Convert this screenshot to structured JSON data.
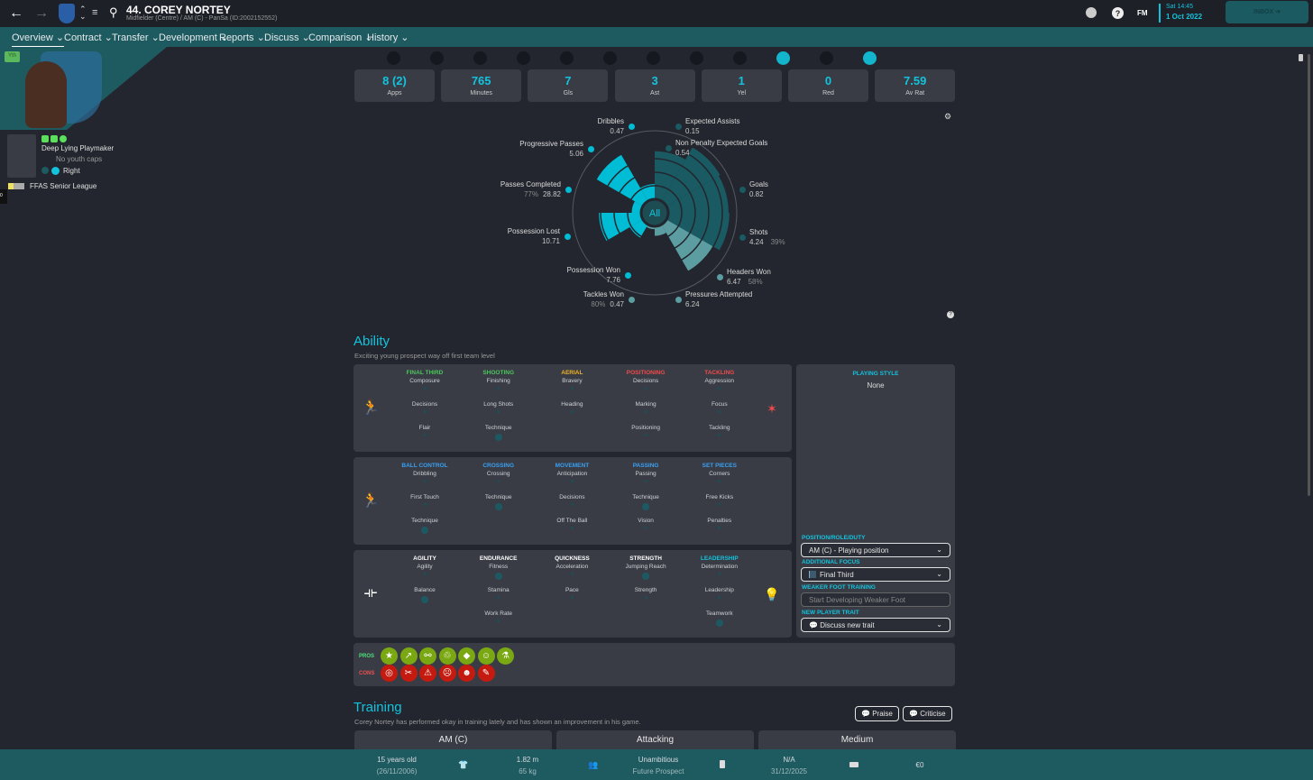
{
  "header": {
    "player_title": "44. COREY NORTEY",
    "subtitle": "Midfielder (Centre) / AM (C) - PanSa (ID:2002152552)",
    "time": "Sat 14:45",
    "date": "1 Oct 2022",
    "fm_label": "FM",
    "inbox_label": "INBOX",
    "icons": [
      "back-arrow-icon",
      "forward-arrow-icon",
      "club-crest-icon",
      "up-down-icon",
      "menu-icon",
      "search-icon",
      "world-icon",
      "help-icon"
    ]
  },
  "nav": {
    "items": [
      {
        "label": "Overview ⌄",
        "active": true
      },
      {
        "label": "Contract ⌄"
      },
      {
        "label": "Transfer ⌄"
      },
      {
        "label": "Development ⌄"
      },
      {
        "label": "Reports ⌄"
      },
      {
        "label": "Discuss ⌄"
      },
      {
        "label": "Comparison ⌄"
      },
      {
        "label": "History ⌄"
      }
    ]
  },
  "player": {
    "badge": "Yth",
    "role": "Deep Lying Playmaker",
    "youth_caps": "No youth caps",
    "foot": "Right",
    "league": "FFAS Senior League",
    "side_tab": "0"
  },
  "stats": [
    {
      "value": "8 (2)",
      "label": "Apps"
    },
    {
      "value": "765",
      "label": "Minutes"
    },
    {
      "value": "7",
      "label": "Gls"
    },
    {
      "value": "3",
      "label": "Ast"
    },
    {
      "value": "1",
      "label": "Yel"
    },
    {
      "value": "0",
      "label": "Red"
    },
    {
      "value": "7.59",
      "label": "Av Rat"
    }
  ],
  "stat_icons": [
    {
      "name": "anchor-icon"
    },
    {
      "name": "book-icon"
    },
    {
      "name": "snail-icon"
    },
    {
      "name": "hammer-sickle-icon"
    },
    {
      "name": "eye-icon"
    },
    {
      "name": "tag-icon"
    },
    {
      "name": "skull-icon"
    },
    {
      "name": "gear-icon"
    },
    {
      "name": "horse-icon"
    },
    {
      "name": "witch-hat-icon",
      "active": true
    },
    {
      "name": "crosshair-icon"
    },
    {
      "name": "fox-icon",
      "active": true
    }
  ],
  "colors": {
    "accent": "#13c3dd",
    "possession": "#00bcd4",
    "attacking": "#1a5a62",
    "defending": "#5c9da2",
    "pros": "#7aa812",
    "cons": "#c41a10"
  },
  "chart_data": {
    "type": "radial-bar",
    "center_label": "All",
    "metrics": [
      {
        "label": "Expected Assists",
        "value": "0.15",
        "group": "attacking",
        "rank": 0.75
      },
      {
        "label": "Non Penalty Expected Goals",
        "value": "0.54",
        "group": "attacking",
        "rank": 0.92
      },
      {
        "label": "Goals",
        "value": "0.82",
        "group": "attacking",
        "rank": 0.9
      },
      {
        "label": "Shots",
        "value": "4.24",
        "pct": "39%",
        "group": "attacking",
        "rank": 0.91
      },
      {
        "label": "Headers Won",
        "value": "6.47",
        "pct": "58%",
        "group": "defending",
        "rank": 0.82
      },
      {
        "label": "Pressures Attempted",
        "value": "6.24",
        "group": "defending",
        "rank": 0.28
      },
      {
        "label": "Tackles Won",
        "value": "0.47",
        "pct": "80%",
        "group": "defending",
        "rank": 0.2
      },
      {
        "label": "Possession Won",
        "value": "7.76",
        "group": "possession",
        "rank": 0.35
      },
      {
        "label": "Possession Lost",
        "value": "10.71",
        "group": "possession",
        "rank": 0.68
      },
      {
        "label": "Passes Completed",
        "value": "28.82",
        "pct": "77%",
        "group": "possession",
        "rank": 0.28
      },
      {
        "label": "Progressive Passes",
        "value": "5.06",
        "group": "possession",
        "rank": 0.82
      },
      {
        "label": "Dribbles",
        "value": "0.47",
        "group": "possession",
        "rank": 0.35
      }
    ]
  },
  "ability": {
    "title": "Ability",
    "subtitle": "Exciting young prospect way off first team level",
    "panels": [
      {
        "icon": "striker-icon",
        "icon_color": "#4cc65a",
        "groups": [
          {
            "name": "FINAL THIRD",
            "color": "#4cc65a",
            "attrs": [
              {
                "n": "Composure"
              },
              {
                "n": "Decisions"
              },
              {
                "n": "Flair"
              }
            ]
          },
          {
            "name": "SHOOTING",
            "color": "#4cc65a",
            "attrs": [
              {
                "n": "Finishing"
              },
              {
                "n": "Long Shots"
              },
              {
                "n": "Technique",
                "big": true
              }
            ]
          },
          {
            "name": "AERIAL",
            "color": "#f0b429",
            "attrs": [
              {
                "n": "Bravery"
              },
              {
                "n": "Heading"
              }
            ]
          },
          {
            "name": "POSITIONING",
            "color": "#f04a4a",
            "attrs": [
              {
                "n": "Decisions"
              },
              {
                "n": "Marking"
              },
              {
                "n": "Positioning"
              }
            ]
          },
          {
            "name": "TACKLING",
            "color": "#f04a4a",
            "attrs": [
              {
                "n": "Aggression"
              },
              {
                "n": "Focus"
              },
              {
                "n": "Tackling"
              }
            ]
          }
        ],
        "icon2": "tackle-icon",
        "icon2_color": "#f04a4a"
      },
      {
        "icon": "dribbler-icon",
        "icon_color": "#3aa0f0",
        "groups": [
          {
            "name": "BALL CONTROL",
            "color": "#3aa0f0",
            "attrs": [
              {
                "n": "Dribbling"
              },
              {
                "n": "First Touch"
              },
              {
                "n": "Technique",
                "big": true
              }
            ]
          },
          {
            "name": "CROSSING",
            "color": "#3aa0f0",
            "attrs": [
              {
                "n": "Crossing"
              },
              {
                "n": "Technique",
                "big": true
              }
            ]
          },
          {
            "name": "MOVEMENT",
            "color": "#3aa0f0",
            "attrs": [
              {
                "n": "Anticipation"
              },
              {
                "n": "Decisions"
              },
              {
                "n": "Off The Ball"
              }
            ]
          },
          {
            "name": "PASSING",
            "color": "#3aa0f0",
            "attrs": [
              {
                "n": "Passing"
              },
              {
                "n": "Technique",
                "big": true
              },
              {
                "n": "Vision"
              }
            ]
          },
          {
            "name": "SET PIECES",
            "color": "#3aa0f0",
            "attrs": [
              {
                "n": "Corners"
              },
              {
                "n": "Free Kicks"
              },
              {
                "n": "Penalties"
              }
            ]
          }
        ]
      },
      {
        "icon": "dumbbell-icon",
        "icon_color": "#ffffff",
        "groups": [
          {
            "name": "AGILITY",
            "color": "#ffffff",
            "attrs": [
              {
                "n": "Agility"
              },
              {
                "n": "Balance",
                "big": true
              }
            ]
          },
          {
            "name": "ENDURANCE",
            "color": "#ffffff",
            "attrs": [
              {
                "n": "Fitness",
                "big": true
              },
              {
                "n": "Stamina"
              },
              {
                "n": "Work Rate"
              }
            ]
          },
          {
            "name": "QUICKNESS",
            "color": "#ffffff",
            "attrs": [
              {
                "n": "Acceleration"
              },
              {
                "n": "Pace"
              }
            ]
          },
          {
            "name": "STRENGTH",
            "color": "#ffffff",
            "attrs": [
              {
                "n": "Jumping Reach",
                "big": true
              },
              {
                "n": "Strength"
              }
            ]
          },
          {
            "name": "LEADERSHIP",
            "color": "#13c3dd",
            "attrs": [
              {
                "n": "Determination"
              },
              {
                "n": "Leadership"
              },
              {
                "n": "Teamwork",
                "big": true
              }
            ]
          }
        ],
        "icon2": "brain-icon",
        "icon2_color": "#13c3dd"
      }
    ]
  },
  "side": {
    "playing_style_label": "PLAYING STYLE",
    "playing_style": "None",
    "position_label": "POSITION/ROLE/DUTY",
    "position_value": "AM (C) - Playing position",
    "focus_label": "ADDITIONAL FOCUS",
    "focus_value": "Final Third",
    "weak_foot_label": "WEAKER FOOT TRAINING",
    "weak_foot_placeholder": "Start Developing Weaker Foot",
    "trait_label": "NEW PLAYER TRAIT",
    "trait_value": "Discuss new trait"
  },
  "traits": {
    "pros_label": "PROS",
    "cons_label": "CONS",
    "pros": [
      "★",
      "↗",
      "⚯",
      "♲",
      "◆",
      "☺",
      "⚗"
    ],
    "cons": [
      "◎",
      "✂",
      "⚠",
      "☹",
      "☻",
      "✎"
    ]
  },
  "training": {
    "title": "Training",
    "text": "Corey Nortey has performed okay in training lately and has shown an improvement in his game.",
    "praise": "Praise",
    "criticise": "Criticise",
    "cards": [
      "AM (C)",
      "Attacking",
      "Medium"
    ]
  },
  "footer": {
    "age": "15 years old",
    "dob": "(26/11/2006)",
    "height": "1.82 m",
    "weight": "65 kg",
    "personality": "Unambitious",
    "status": "Future Prospect",
    "contract": "N/A",
    "contract_end": "31/12/2025",
    "value": "€0"
  }
}
